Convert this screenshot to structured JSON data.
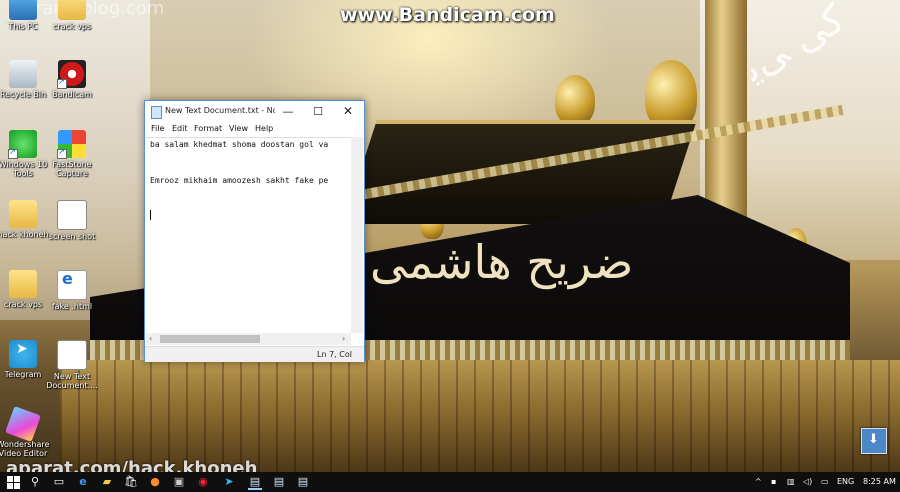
{
  "watermarks": {
    "bandicam": "www.Bandicam.com",
    "top_left": "iranhiblog.com",
    "bottom": "aparat.com/hack.khoneh"
  },
  "desktop_icons": [
    {
      "label": "This PC",
      "icon": "computer-icon"
    },
    {
      "label": "crack vps",
      "icon": "folder-icon"
    },
    {
      "label": "Recycle Bin",
      "icon": "recycle-bin-icon"
    },
    {
      "label": "Bandicam",
      "icon": "bandicam-icon"
    },
    {
      "label": "Windows 10 Tools",
      "icon": "windows10-tools-icon"
    },
    {
      "label": "FastStone Capture",
      "icon": "faststone-capture-icon"
    },
    {
      "label": "hack khoneh",
      "icon": "folder-icon"
    },
    {
      "label": "screen shot",
      "icon": "document-icon"
    },
    {
      "label": "crack vps",
      "icon": "folder-icon"
    },
    {
      "label": "fake .html",
      "icon": "edge-html-icon"
    },
    {
      "label": "Telegram",
      "icon": "telegram-icon"
    },
    {
      "label": "New Text Document....",
      "icon": "text-document-icon"
    },
    {
      "label": "Wondershare Video Editor",
      "icon": "wondershare-icon"
    }
  ],
  "notepad": {
    "title": "New Text Document.txt - No...",
    "controls": {
      "minimize": "—",
      "maximize": "☐",
      "close": "✕"
    },
    "menu": [
      "File",
      "Edit",
      "Format",
      "View",
      "Help"
    ],
    "lines": [
      "ba salam khedmat shoma doostan gol va",
      "",
      "",
      "Emrooz mikhaim amoozesh sakht fake pe"
    ],
    "status": "Ln 7, Col"
  },
  "taskbar": {
    "pinned": [
      "search-icon",
      "task-view-icon",
      "edge-icon",
      "file-explorer-icon",
      "store-icon",
      "firefox-icon",
      "cmd-icon",
      "bandicam-icon",
      "telegram-icon",
      "notepad-icon",
      "notepad-icon",
      "notepad-icon"
    ],
    "tray": {
      "chevron": "^",
      "language": "ENG",
      "time": "8:25 AM"
    }
  },
  "colors": {
    "taskbar": "#0f0f10",
    "window_border": "#5a8fd0",
    "accent": "#4a88c7"
  }
}
